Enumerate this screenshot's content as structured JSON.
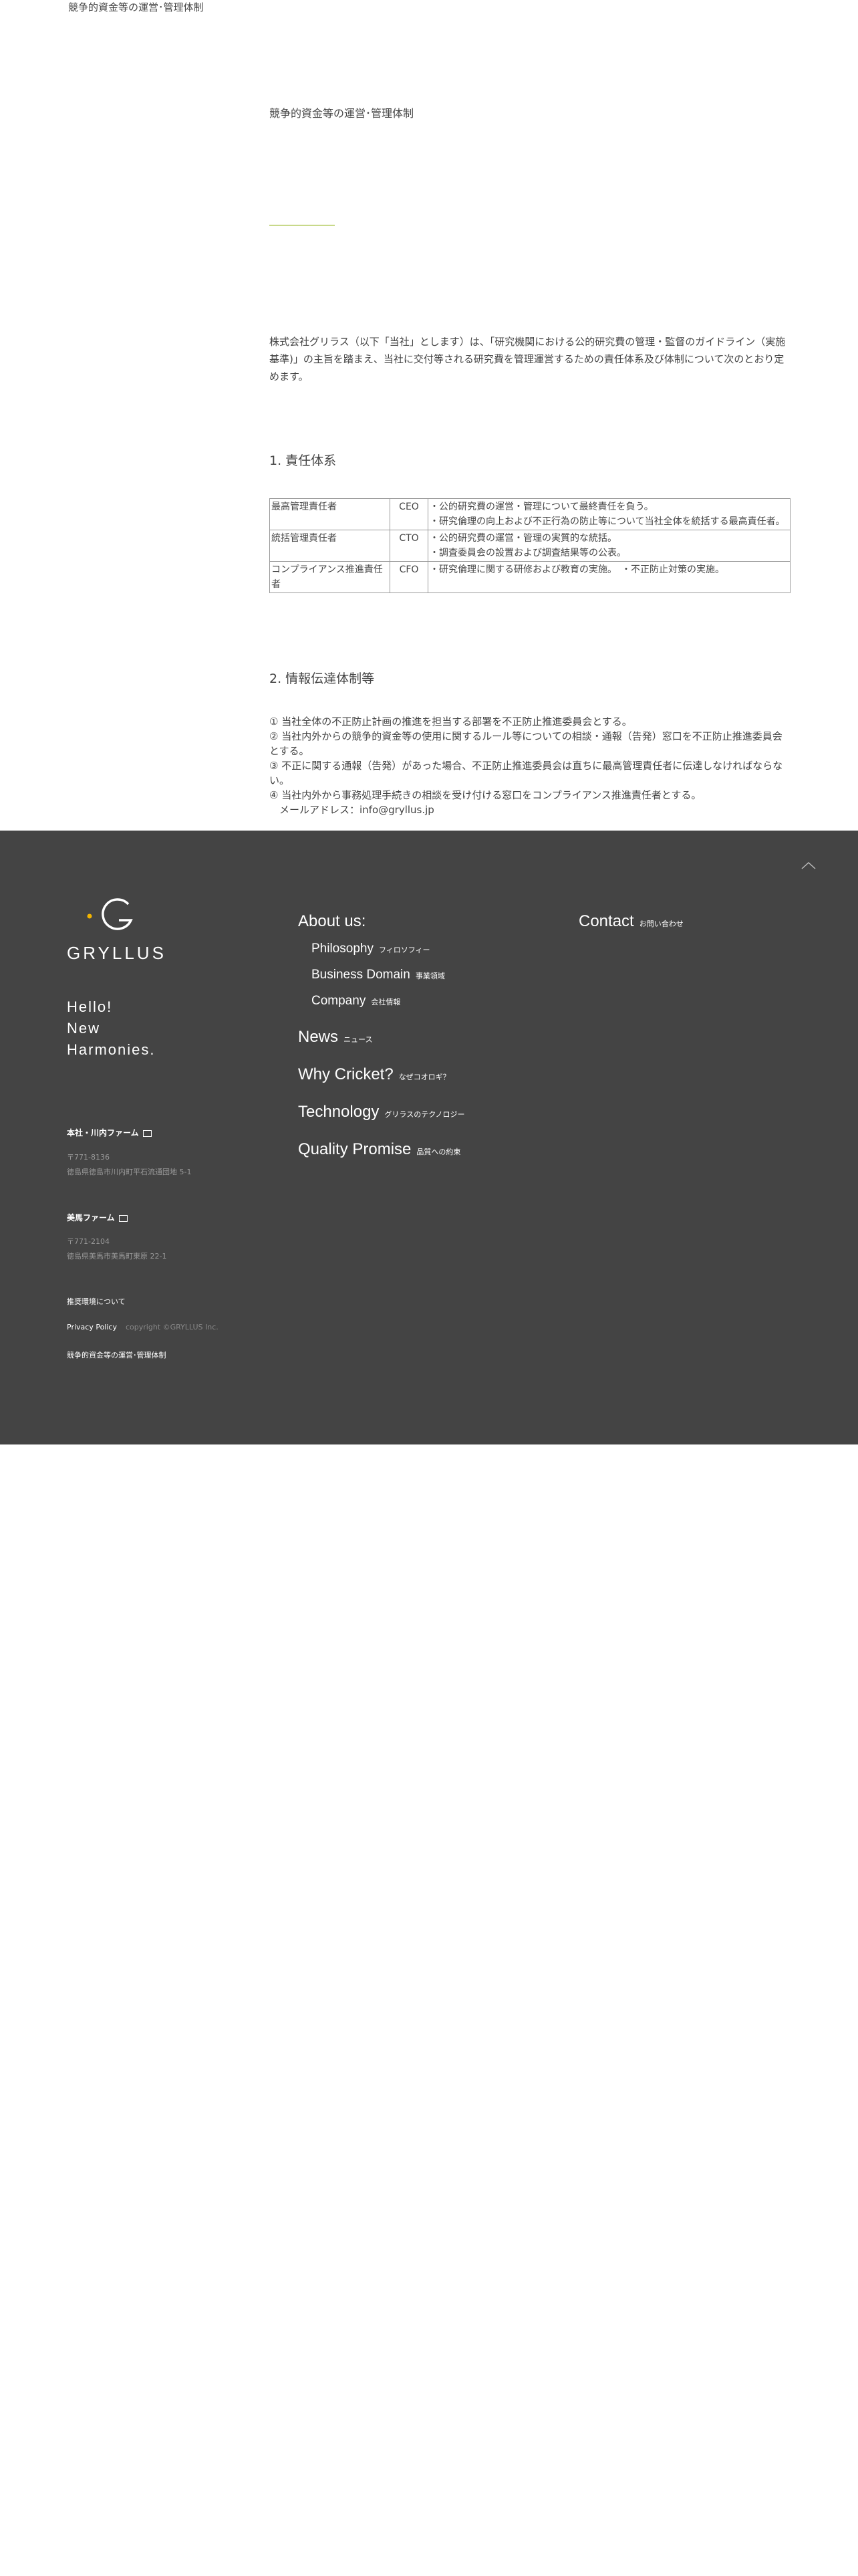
{
  "header": {
    "breadcrumb": "競争的資金等の運営･管理体制"
  },
  "page": {
    "title": "競争的資金等の運営･管理体制",
    "intro": "株式会社グリラス（以下「当社」とします）は、｢研究機関における公的研究費の管理・監督のガイドライン（実施基準)」の主旨を踏まえ、当社に交付等される研究費を管理運営するための責任体系及び体制について次のとおり定めます。",
    "section1_heading": "1. 責任体系",
    "table": [
      {
        "role": "最高管理責任者",
        "title": "CEO",
        "duties": [
          "・公的研究費の運営・管理について最終責任を負う。",
          "・研究倫理の向上および不正行為の防止等について当社全体を統括する最高責任者。"
        ]
      },
      {
        "role": "統括管理責任者",
        "title": "CTO",
        "duties": [
          "・公的研究費の運営・管理の実質的な統括。",
          "・調査委員会の設置および調査結果等の公表。"
        ]
      },
      {
        "role": "コンプライアンス推進責任者",
        "title": "CFO",
        "duties": [
          "・研究倫理に関する研修および教育の実施。　・不正防止対策の実施。"
        ]
      }
    ],
    "section2_heading": "2. 情報伝達体制等",
    "info_lines": [
      "① 当社全体の不正防止計画の推進を担当する部署を不正防止推進委員会とする。",
      "② 当社内外からの競争的資金等の使用に関するルール等についての相談・通報（告発）窓口を不正防止推進委員会とする。",
      "③ 不正に関する通報（告発）があった場合、不正防止推進委員会は直ちに最高管理責任者に伝達しなければならない。",
      "④ 当社内外から事務処理手続きの相談を受け付ける窓口をコンプライアンス推進責任者とする。",
      "　メールアドレス：info@gryllus.jp"
    ]
  },
  "footer": {
    "logo_text": "GRYLLUS",
    "tagline": [
      "Hello!",
      "New",
      "Harmonies."
    ],
    "offices": [
      {
        "name": "本社・川内ファーム",
        "postal": "〒771-8136",
        "address": "徳島県徳島市川内町平石流通団地 5-1"
      },
      {
        "name": "美馬ファーム",
        "postal": "〒771-2104",
        "address": "徳島県美馬市美馬町東原 22-1"
      }
    ],
    "links": {
      "recommended_env": "推奨環境について",
      "privacy": "Privacy Policy",
      "copyright": "copyright ©GRYLLUS Inc.",
      "funding": "競争的資金等の運営･管理体制"
    },
    "nav": {
      "about": {
        "en": "About us:",
        "jp": ""
      },
      "philosophy": {
        "en": "Philosophy",
        "jp": "フィロソフィー"
      },
      "business": {
        "en": "Business Domain",
        "jp": "事業領域"
      },
      "company": {
        "en": "Company",
        "jp": "会社情報"
      },
      "news": {
        "en": "News",
        "jp": "ニュース"
      },
      "cricket": {
        "en": "Why Cricket?",
        "jp": "なぜコオロギ？"
      },
      "technology": {
        "en": "Technology",
        "jp": "グリラスのテクノロジー"
      },
      "quality": {
        "en": "Quality Promise",
        "jp": "品質への約束"
      },
      "contact": {
        "en": "Contact",
        "jp": "お問い合わせ"
      }
    },
    "colors": {
      "background": "#444444",
      "accent": "#f2b400"
    }
  }
}
